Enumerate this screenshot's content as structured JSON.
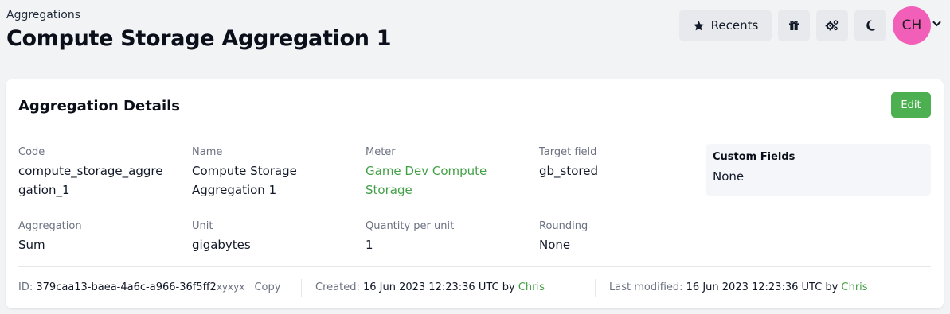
{
  "header": {
    "breadcrumb": "Aggregations",
    "title": "Compute Storage Aggregation 1",
    "recents_label": "Recents",
    "avatar_initials": "CH"
  },
  "card": {
    "title": "Aggregation Details",
    "edit_label": "Edit",
    "fields": {
      "code": {
        "label": "Code",
        "value_line1": "compute_storage_aggre",
        "value_line2": "gation_1"
      },
      "name": {
        "label": "Name",
        "value_line1": "Compute Storage",
        "value_line2": "Aggregation 1"
      },
      "meter": {
        "label": "Meter",
        "value_line1": "Game Dev Compute",
        "value_line2": "Storage"
      },
      "target_field": {
        "label": "Target field",
        "value": "gb_stored"
      },
      "aggregation": {
        "label": "Aggregation",
        "value": "Sum"
      },
      "unit": {
        "label": "Unit",
        "value": "gigabytes"
      },
      "quantity_per_unit": {
        "label": "Quantity per unit",
        "value": "1"
      },
      "rounding": {
        "label": "Rounding",
        "value": "None"
      }
    },
    "custom_fields": {
      "title": "Custom Fields",
      "value": "None"
    },
    "footer": {
      "id_label": "ID:",
      "id_value": "379caa13-baea-4a6c-a966-36f5ff2",
      "id_suffix": "xyxyx",
      "copy_label": "Copy",
      "created_label": "Created:",
      "created_value": "16 Jun 2023 12:23:36 UTC by",
      "created_by": "Chris",
      "modified_label": "Last modified:",
      "modified_value": "16 Jun 2023 12:23:36 UTC by",
      "modified_by": "Chris"
    }
  },
  "colors": {
    "accent_green": "#4caf50",
    "link_green": "#43a047",
    "avatar_pink": "#f25fb8"
  },
  "icons": {
    "recents": "star-icon",
    "gift": "gift-icon",
    "settings": "cogs-icon",
    "theme": "moon-icon",
    "avatar_menu": "chevron-down-icon"
  }
}
